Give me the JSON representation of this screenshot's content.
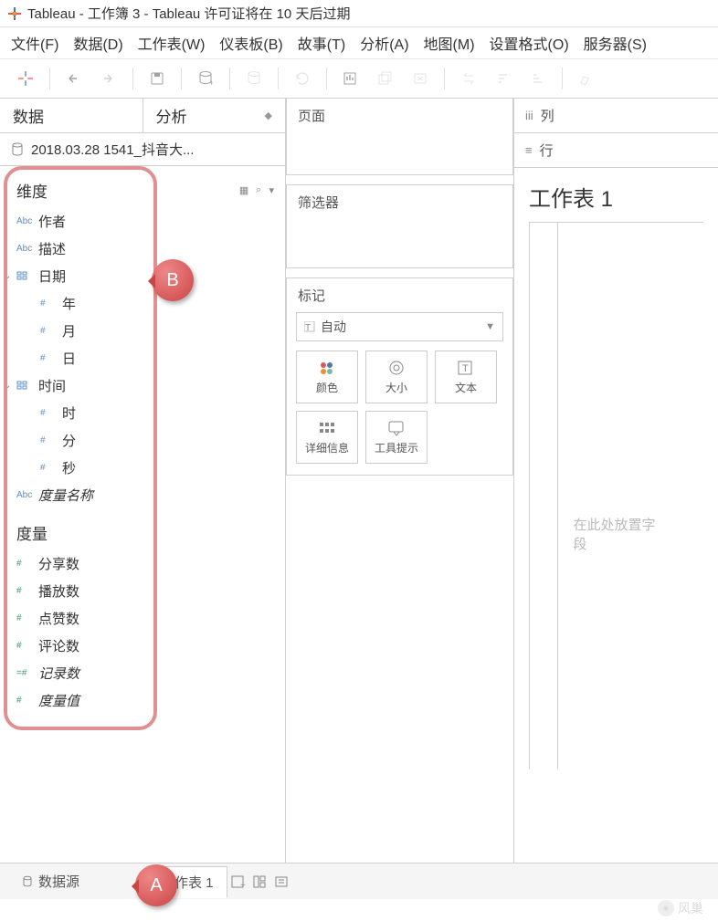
{
  "app": {
    "title": "Tableau - 工作簿 3 - Tableau 许可证将在 10 天后过期"
  },
  "menu": {
    "file": "文件(F)",
    "data": "数据(D)",
    "worksheet": "工作表(W)",
    "dashboard": "仪表板(B)",
    "story": "故事(T)",
    "analysis": "分析(A)",
    "map": "地图(M)",
    "format": "设置格式(O)",
    "server": "服务器(S)"
  },
  "sidepanel": {
    "tab_data": "数据",
    "tab_analytics": "分析",
    "datasource": "2018.03.28 1541_抖音大...",
    "dimensions_label": "维度",
    "measures_label": "度量",
    "dimensions": {
      "author": "作者",
      "description": "描述",
      "date": "日期",
      "year": "年",
      "month": "月",
      "day": "日",
      "time": "时间",
      "hour": "时",
      "minute": "分",
      "second": "秒",
      "measure_names": "度量名称"
    },
    "measures": {
      "shares": "分享数",
      "plays": "播放数",
      "likes": "点赞数",
      "comments": "评论数",
      "records": "记录数",
      "measure_values": "度量值"
    }
  },
  "cards": {
    "pages": "页面",
    "filters": "筛选器",
    "marks": "标记",
    "marks_dropdown": "自动",
    "mark_color": "颜色",
    "mark_size": "大小",
    "mark_text": "文本",
    "mark_detail": "详细信息",
    "mark_tooltip": "工具提示"
  },
  "shelves": {
    "columns": "列",
    "rows": "行"
  },
  "sheet": {
    "title": "工作表 1",
    "drop_hint": "在此处放置字段"
  },
  "bottom": {
    "datasource_tab": "数据源",
    "sheet_tab": "工作表 1"
  },
  "callouts": {
    "a": "A",
    "b": "B"
  },
  "watermark": "风巢"
}
